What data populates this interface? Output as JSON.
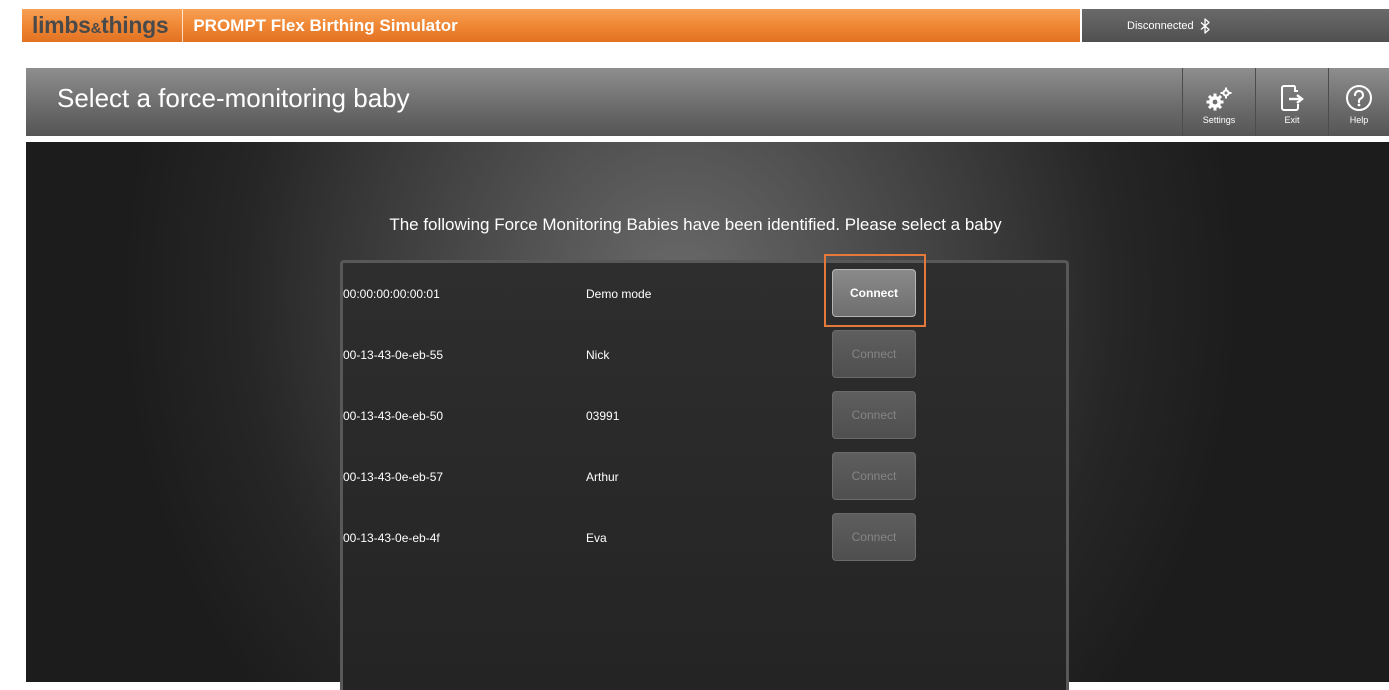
{
  "brand": {
    "logo_left": "limbs",
    "logo_amp": "&",
    "logo_right": "things",
    "app_title": "PROMPT Flex Birthing Simulator",
    "status": "Disconnected"
  },
  "header": {
    "title": "Select a force-monitoring baby",
    "tools": {
      "settings": "Settings",
      "exit": "Exit",
      "help": "Help"
    }
  },
  "main": {
    "instruction": "The following Force Monitoring Babies have been identified. Please select a baby",
    "babies": [
      {
        "address": "00:00:00:00:00:01",
        "name": "Demo mode",
        "button": "Connect",
        "enabled": true
      },
      {
        "address": "00-13-43-0e-eb-55",
        "name": "Nick",
        "button": "Connect",
        "enabled": false
      },
      {
        "address": "00-13-43-0e-eb-50",
        "name": "03991",
        "button": "Connect",
        "enabled": false
      },
      {
        "address": "00-13-43-0e-eb-57",
        "name": "Arthur",
        "button": "Connect",
        "enabled": false
      },
      {
        "address": "00-13-43-0e-eb-4f",
        "name": "Eva",
        "button": "Connect",
        "enabled": false
      }
    ]
  },
  "colors": {
    "brand_orange": "#f08a38",
    "highlight": "#e5783b"
  },
  "icons": {
    "bluetooth": "bluetooth-icon",
    "settings": "gear-icon",
    "exit": "exit-icon",
    "help": "help-icon"
  }
}
